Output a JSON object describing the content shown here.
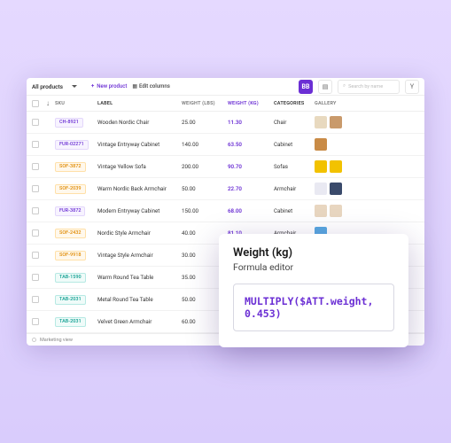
{
  "toolbar": {
    "scope_label": "All products",
    "new_product": "New product",
    "edit_columns": "Edit columns",
    "search_placeholder": "Search by name",
    "icon_btn_label": "BB",
    "right_btn": "Y"
  },
  "columns": {
    "sku": "SKU",
    "label": "LABEL",
    "weight_lbs": "WEIGHT (LBS)",
    "weight_kg": "WEIGHT (KG)",
    "categories": "CATEGORIES",
    "gallery": "GALLERY"
  },
  "rows": [
    {
      "sku": "CH-8921",
      "sku_color": "purple",
      "label": "Wooden Nordic Chair",
      "lbs": "25.00",
      "kg": "11.30",
      "cat": "Chair",
      "thumbs": [
        "#e8d9bf",
        "#c99a6b"
      ]
    },
    {
      "sku": "FUR-02271",
      "sku_color": "purple",
      "label": "Vintage Entryway Cabinet",
      "lbs": "140.00",
      "kg": "63.50",
      "cat": "Cabinet",
      "thumbs": [
        "#c98b46"
      ]
    },
    {
      "sku": "SOF-3872",
      "sku_color": "orange",
      "label": "Vintage Yellow Sofa",
      "lbs": "200.00",
      "kg": "90.70",
      "cat": "Sofas",
      "thumbs": [
        "#f2c200",
        "#f2c200"
      ]
    },
    {
      "sku": "SOF-2039",
      "sku_color": "orange",
      "label": "Warm Nordic Back Armchair",
      "lbs": "50.00",
      "kg": "22.70",
      "cat": "Armchair",
      "thumbs": [
        "#e9e9f2",
        "#3a4a6b"
      ]
    },
    {
      "sku": "FUR-3872",
      "sku_color": "purple",
      "label": "Modern Entryway Cabinet",
      "lbs": "150.00",
      "kg": "68.00",
      "cat": "Cabinet",
      "thumbs": [
        "#e8d6c0",
        "#e8d6c0"
      ]
    },
    {
      "sku": "SOF-2432",
      "sku_color": "orange",
      "label": "Nordic Style Armchair",
      "lbs": "40.00",
      "kg": "81.10",
      "cat": "Armchair",
      "thumbs": [
        "#5aa8e0"
      ]
    },
    {
      "sku": "SOF-9918",
      "sku_color": "orange",
      "label": "Vintage Style Armchair",
      "lbs": "30.00",
      "kg": "",
      "cat": "",
      "thumbs": []
    },
    {
      "sku": "TAB-1590",
      "sku_color": "teal",
      "label": "Warm Round Tea Table",
      "lbs": "35.00",
      "kg": "",
      "cat": "",
      "thumbs": []
    },
    {
      "sku": "TAB-2031",
      "sku_color": "teal",
      "label": "Metal Round Tea Table",
      "lbs": "50.00",
      "kg": "",
      "cat": "",
      "thumbs": []
    },
    {
      "sku": "TAB-2031",
      "sku_color": "teal",
      "label": "Velvet Green Armchair",
      "lbs": "60.00",
      "kg": "",
      "cat": "",
      "thumbs": []
    }
  ],
  "footer": {
    "label": "Marketing view"
  },
  "formula": {
    "title": "Weight (kg)",
    "subtitle": "Formula editor",
    "expression": "MULTIPLY($ATT.weight, 0.453)"
  }
}
